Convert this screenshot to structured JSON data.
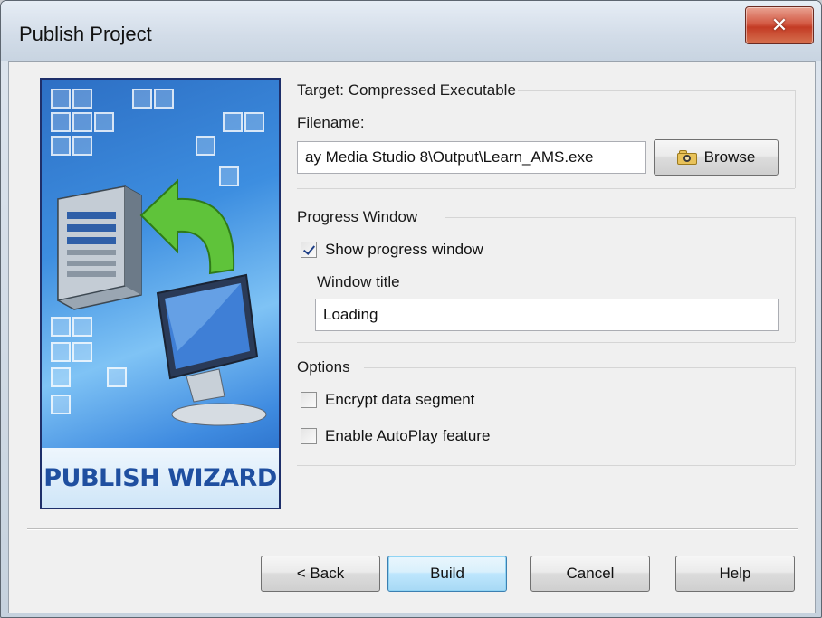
{
  "window": {
    "title": "Publish Project",
    "close_glyph": "✕"
  },
  "wizard": {
    "banner_text": "PUBLISH WIZARD"
  },
  "target": {
    "heading": "Target: Compressed Executable",
    "filename_label": "Filename:",
    "filename_value": "ay Media Studio 8\\Output\\Learn_AMS.exe",
    "browse_label": "Browse"
  },
  "progress": {
    "heading": "Progress Window",
    "show_label": "Show progress window",
    "show_checked": true,
    "title_label": "Window title",
    "title_value": "Loading"
  },
  "options": {
    "heading": "Options",
    "encrypt_label": "Encrypt data segment",
    "encrypt_checked": false,
    "autoplay_label": "Enable AutoPlay feature",
    "autoplay_checked": false
  },
  "buttons": {
    "back": "< Back",
    "build": "Build",
    "cancel": "Cancel",
    "help": "Help"
  },
  "icons": {
    "close": "close-icon",
    "browse": "folder-search-icon",
    "wizard": "server-to-computer-icon"
  }
}
